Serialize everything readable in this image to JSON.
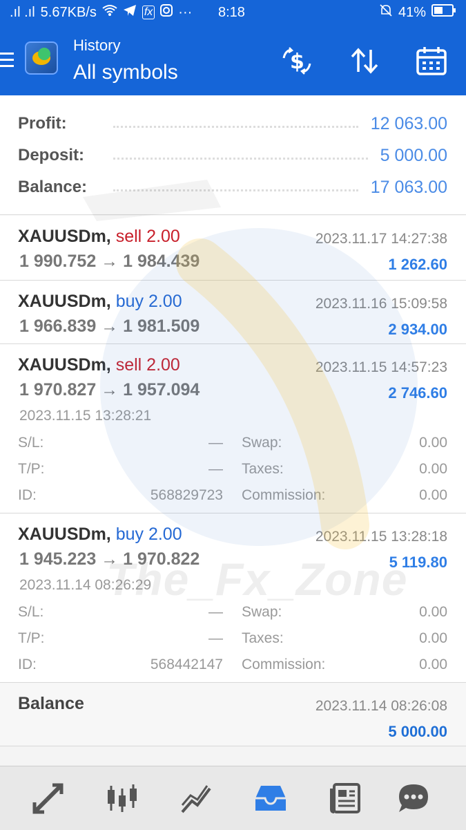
{
  "status": {
    "signal": ".ıl .ıl",
    "speed": "5.67KB/s",
    "dots": "···",
    "time": "8:18",
    "battery": "41%"
  },
  "header": {
    "section": "History",
    "title": "All symbols"
  },
  "summary": {
    "profit_label": "Profit:",
    "profit_value": "12 063.00",
    "deposit_label": "Deposit:",
    "deposit_value": "5 000.00",
    "balance_label": "Balance:",
    "balance_value": "17 063.00"
  },
  "deals": [
    {
      "symbol": "XAUUSDm,",
      "side": "sell 2.00",
      "time": "2023.11.17 14:27:38",
      "price": "1 990.752 → 1 984.439",
      "profit": "1 262.60"
    },
    {
      "symbol": "XAUUSDm,",
      "side": "buy 2.00",
      "time": "2023.11.16 15:09:58",
      "price": "1 966.839 → 1 981.509",
      "profit": "2 934.00"
    },
    {
      "symbol": "XAUUSDm,",
      "side": "sell 2.00",
      "time": "2023.11.15 14:57:23",
      "price": "1 970.827 → 1 957.094",
      "profit": "2 746.60",
      "open_time": "2023.11.15 13:28:21",
      "sl_label": "S/L:",
      "sl": "—",
      "tp_label": "T/P:",
      "tp": "—",
      "id_label": "ID:",
      "id": "568829723",
      "swap_label": "Swap:",
      "swap": "0.00",
      "taxes_label": "Taxes:",
      "taxes": "0.00",
      "comm_label": "Commission:",
      "comm": "0.00"
    },
    {
      "symbol": "XAUUSDm,",
      "side": "buy 2.00",
      "time": "2023.11.15 13:28:18",
      "price": "1 945.223 → 1 970.822",
      "profit": "5 119.80",
      "open_time": "2023.11.14 08:26:29",
      "sl_label": "S/L:",
      "sl": "—",
      "tp_label": "T/P:",
      "tp": "—",
      "id_label": "ID:",
      "id": "568442147",
      "swap_label": "Swap:",
      "swap": "0.00",
      "taxes_label": "Taxes:",
      "taxes": "0.00",
      "comm_label": "Commission:",
      "comm": "0.00"
    }
  ],
  "balance_op": {
    "label": "Balance",
    "time": "2023.11.14 08:26:08",
    "value": "5 000.00"
  },
  "watermark": "The_Fx_Zone",
  "nav": [
    "trade-icon",
    "chart-icon",
    "history-chart-icon",
    "inbox-icon",
    "news-icon",
    "chat-icon"
  ],
  "colors": {
    "primary": "#1565d8",
    "sell": "#c8202b",
    "buy": "#2569d4",
    "profit": "#2f7ee6"
  }
}
